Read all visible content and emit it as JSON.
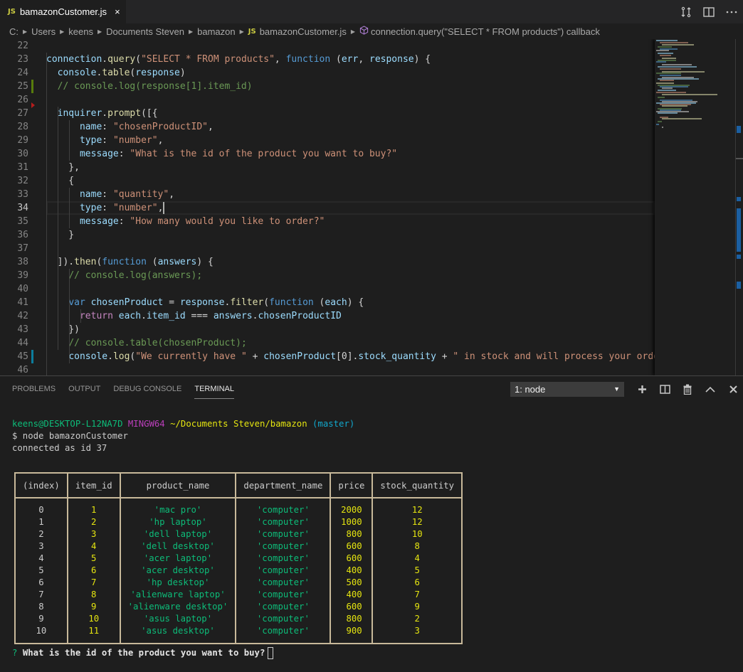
{
  "tab": {
    "badge": "JS",
    "title": "bamazonCustomer.js",
    "close": "×"
  },
  "editor_actions": [
    {
      "name": "open-changes-icon",
      "glyph": "⇅"
    },
    {
      "name": "split-editor-icon",
      "glyph": "◫"
    },
    {
      "name": "more-actions-icon",
      "glyph": "···"
    }
  ],
  "breadcrumb": {
    "items": [
      "C:",
      "Users",
      "keens",
      "Documents Steven",
      "bamazon"
    ],
    "file_badge": "JS",
    "file": "bamazonCustomer.js",
    "symbol": "connection.query(\"SELECT * FROM products\") callback"
  },
  "editor": {
    "active_line": 34,
    "lines": [
      {
        "n": "22",
        "html": ""
      },
      {
        "n": "23",
        "html": "<span class='v'>connection</span>.<span class='f'>query</span>(<span class='s'>\"SELECT * FROM products\"</span>, <span class='k'>function</span> (<span class='v'>err</span>, <span class='v'>response</span>) {"
      },
      {
        "n": "24",
        "html": "  <span class='v'>console</span>.<span class='f'>table</span>(<span class='v'>response</span>)"
      },
      {
        "n": "25",
        "html": "  <span class='c'>// console.log(response[1].item_id)</span>"
      },
      {
        "n": "26",
        "html": ""
      },
      {
        "n": "27",
        "html": "  <span class='v'>inquirer</span>.<span class='f'>prompt</span>([{"
      },
      {
        "n": "28",
        "html": "      <span class='v'>name</span>: <span class='s'>\"chosenProductID\"</span>,"
      },
      {
        "n": "29",
        "html": "      <span class='v'>type</span>: <span class='s'>\"number\"</span>,"
      },
      {
        "n": "30",
        "html": "      <span class='v'>message</span>: <span class='s'>\"What is the id of the product you want to buy?\"</span>"
      },
      {
        "n": "31",
        "html": "    },"
      },
      {
        "n": "32",
        "html": "    {"
      },
      {
        "n": "33",
        "html": "      <span class='v'>name</span>: <span class='s'>\"quantity\"</span>,"
      },
      {
        "n": "34",
        "html": "      <span class='v'>type</span>: <span class='s'>\"number\"</span>,<span class='cursor'></span>"
      },
      {
        "n": "35",
        "html": "      <span class='v'>message</span>: <span class='s'>\"How many would you like to order?\"</span>"
      },
      {
        "n": "36",
        "html": "    }"
      },
      {
        "n": "37",
        "html": ""
      },
      {
        "n": "38",
        "html": "  ]).<span class='f'>then</span>(<span class='k'>function</span> (<span class='v'>answers</span>) {"
      },
      {
        "n": "39",
        "html": "    <span class='c'>// console.log(answers);</span>"
      },
      {
        "n": "40",
        "html": ""
      },
      {
        "n": "41",
        "html": "    <span class='k'>var</span> <span class='v'>chosenProduct</span> = <span class='v'>response</span>.<span class='f'>filter</span>(<span class='k'>function</span> (<span class='v'>each</span>) {"
      },
      {
        "n": "42",
        "html": "      <span class='r'>return</span> <span class='v'>each</span>.<span class='v'>item_id</span> === <span class='v'>answers</span>.<span class='v'>chosenProductID</span>"
      },
      {
        "n": "43",
        "html": "    })"
      },
      {
        "n": "44",
        "html": "    <span class='c'>// console.table(chosenProduct);</span>"
      },
      {
        "n": "45",
        "html": "    <span class='v'>console</span>.<span class='f'>log</span>(<span class='s'>\"We currently have \"</span> + <span class='v'>chosenProduct</span>[<span class='p'>0</span>].<span class='v'>stock_quantity</span> + <span class='s'>\" in stock and will process your order</span>"
      },
      {
        "n": "46",
        "html": ""
      }
    ]
  },
  "panel": {
    "tabs": [
      "PROBLEMS",
      "OUTPUT",
      "DEBUG CONSOLE",
      "TERMINAL"
    ],
    "active_tab": "TERMINAL",
    "terminal_select": "1: node",
    "actions": [
      {
        "name": "new-terminal-icon",
        "glyph": "✚"
      },
      {
        "name": "split-terminal-icon",
        "glyph": "◫"
      },
      {
        "name": "kill-terminal-icon",
        "glyph": "🗑"
      },
      {
        "name": "maximize-panel-icon",
        "glyph": "︿"
      },
      {
        "name": "close-panel-icon",
        "glyph": "✕"
      }
    ]
  },
  "terminal": {
    "prompt_user": "keens@DESKTOP-L12NA7D",
    "prompt_env": "MINGW64",
    "prompt_path": "~/Documents Steven/bamazon",
    "prompt_branch": "(master)",
    "command": "$ node bamazonCustomer",
    "output": "connected as id 37",
    "table": {
      "columns": [
        "(index)",
        "item_id",
        "product_name",
        "department_name",
        "price",
        "stock_quantity"
      ],
      "rows": [
        [
          "0",
          "1",
          "'mac pro'",
          "'computer'",
          "2000",
          "12"
        ],
        [
          "1",
          "2",
          "'hp laptop'",
          "'computer'",
          "1000",
          "12"
        ],
        [
          "2",
          "3",
          "'dell laptop'",
          "'computer'",
          " 800",
          "10"
        ],
        [
          "3",
          "4",
          "'dell desktop'",
          "'computer'",
          " 600",
          "8"
        ],
        [
          "4",
          "5",
          "'acer laptop'",
          "'computer'",
          " 600",
          "4"
        ],
        [
          "5",
          "6",
          "'acer desktop'",
          "'computer'",
          " 400",
          "5"
        ],
        [
          "6",
          "7",
          "'hp desktop'",
          "'computer'",
          " 500",
          "6"
        ],
        [
          "7",
          "8",
          "'alienware laptop'",
          "'computer'",
          " 400",
          "7"
        ],
        [
          "8",
          "9",
          "'alienware desktop'",
          "'computer'",
          " 600",
          "9"
        ],
        [
          "9",
          "10",
          "'asus laptop'",
          "'computer'",
          " 800",
          "2"
        ],
        [
          "10",
          "11",
          "'asus desktop'",
          "'computer'",
          " 900",
          "3"
        ]
      ]
    },
    "question_mark": "?",
    "question": "What is the id of the product you want to buy?"
  }
}
